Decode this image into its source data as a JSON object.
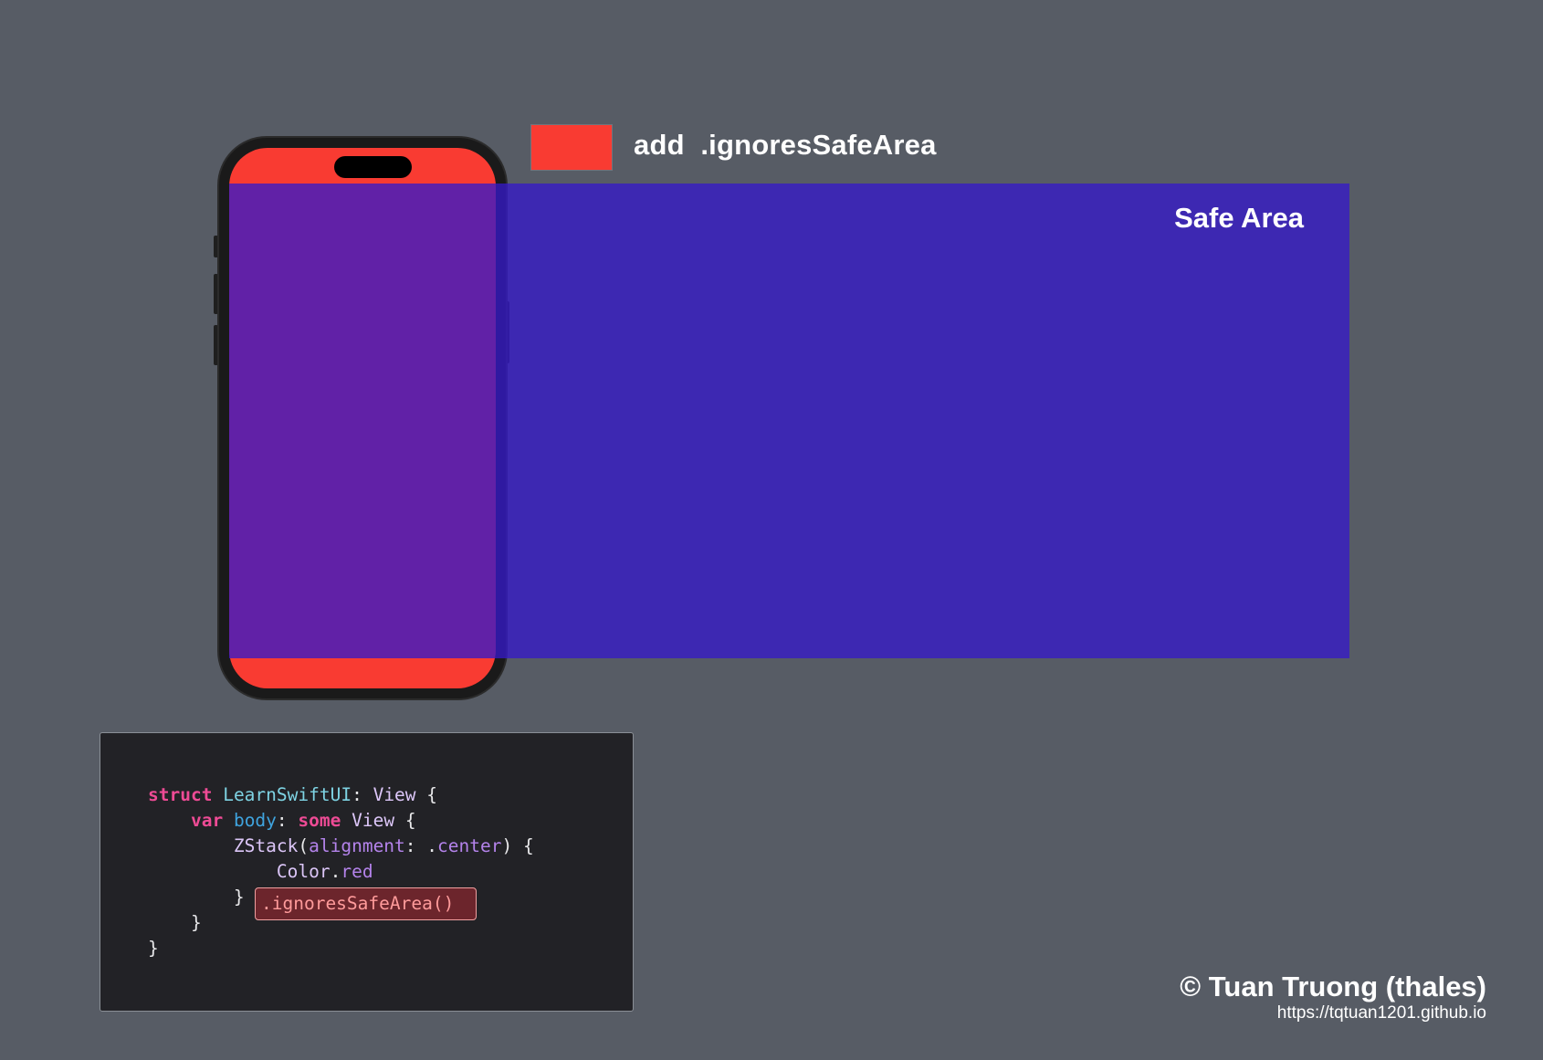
{
  "legend": {
    "swatch_color": "#f93b32",
    "label": "add  .ignoresSafeArea"
  },
  "phone": {
    "screen_color": "#f93b32"
  },
  "safe_area": {
    "label": "Safe Area",
    "color": "#361ac8"
  },
  "code": {
    "lines": [
      [
        {
          "t": "struct",
          "c": "kw"
        },
        {
          "t": " ",
          "c": "pl"
        },
        {
          "t": "LearnSwiftUI",
          "c": "ty"
        },
        {
          "t": ": ",
          "c": "pl"
        },
        {
          "t": "View",
          "c": "ty2"
        },
        {
          "t": " {",
          "c": "pl"
        }
      ],
      [
        {
          "t": "    ",
          "c": "pl"
        },
        {
          "t": "var",
          "c": "kw"
        },
        {
          "t": " ",
          "c": "pl"
        },
        {
          "t": "body",
          "c": "pr"
        },
        {
          "t": ": ",
          "c": "pl"
        },
        {
          "t": "some",
          "c": "kw"
        },
        {
          "t": " ",
          "c": "pl"
        },
        {
          "t": "View",
          "c": "ty2"
        },
        {
          "t": " {",
          "c": "pl"
        }
      ],
      [
        {
          "t": "        ",
          "c": "pl"
        },
        {
          "t": "ZStack",
          "c": "ty2"
        },
        {
          "t": "(",
          "c": "pl"
        },
        {
          "t": "alignment",
          "c": "lb"
        },
        {
          "t": ": .",
          "c": "pl"
        },
        {
          "t": "center",
          "c": "lb"
        },
        {
          "t": ") {",
          "c": "pl"
        }
      ],
      [
        {
          "t": "            ",
          "c": "pl"
        },
        {
          "t": "Color",
          "c": "ty2"
        },
        {
          "t": ".",
          "c": "pl"
        },
        {
          "t": "red",
          "c": "lb"
        }
      ],
      [
        {
          "t": "        }",
          "c": "pl"
        }
      ],
      [
        {
          "t": "    }",
          "c": "pl"
        }
      ],
      [
        {
          "t": "}",
          "c": "pl"
        }
      ]
    ],
    "highlight": ".ignoresSafeArea()"
  },
  "credit": {
    "name": "© Tuan Truong (thales)",
    "url": "https://tqtuan1201.github.io"
  }
}
